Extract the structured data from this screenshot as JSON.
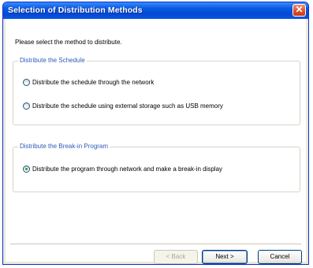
{
  "dialog": {
    "title": "Selection of Distribution Methods",
    "close_glyph": "✕",
    "prompt": "Please select the method to distribute."
  },
  "groups": [
    {
      "legend": "Distribute the Schedule",
      "options": [
        {
          "label": "Distribute the schedule through the network",
          "checked": false
        },
        {
          "label": "Distribute the schedule using external storage such as USB memory",
          "checked": false
        }
      ]
    },
    {
      "legend": "Distribute the Break-in Program",
      "options": [
        {
          "label": "Distribute the program through network and make a break-in display",
          "checked": true
        }
      ]
    }
  ],
  "buttons": {
    "back": "< Back",
    "next": "Next >",
    "cancel": "Cancel"
  },
  "colors": {
    "title_bar": "#0a5be0",
    "legend_text": "#2f5bb8",
    "close_button": "#d8502a"
  },
  "icons": [
    "close-icon",
    "radio-icon"
  ]
}
